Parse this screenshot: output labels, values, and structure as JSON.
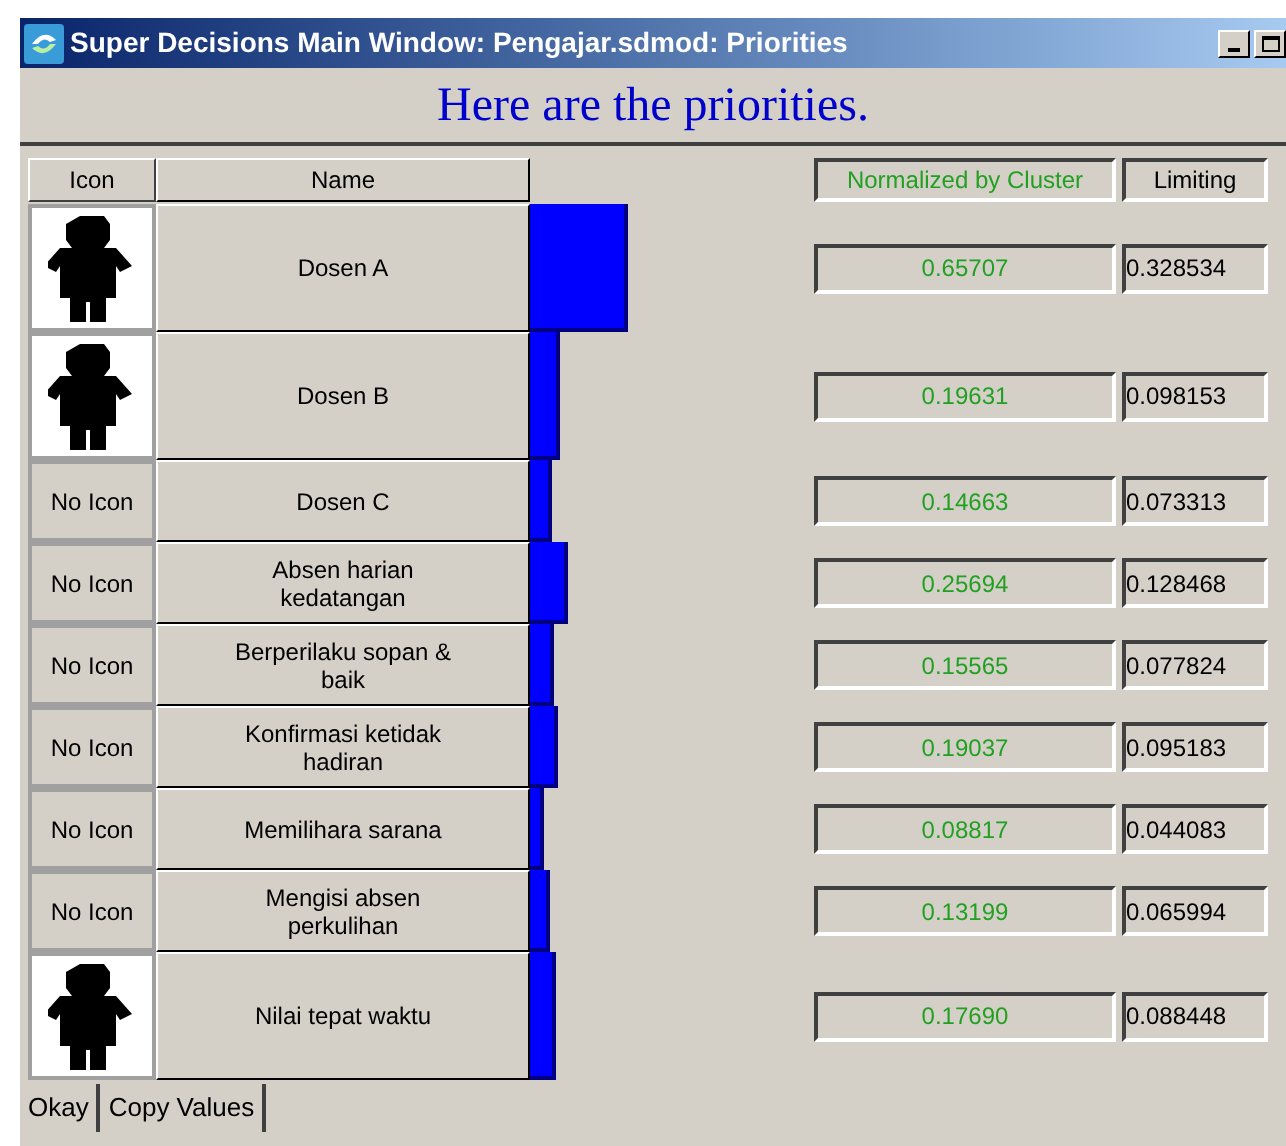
{
  "window": {
    "title": "Super Decisions Main Window: Pengajar.sdmod: Priorities"
  },
  "heading": "Here are the priorities.",
  "columns": {
    "icon": "Icon",
    "name": "Name",
    "normalized": "Normalized by Cluster",
    "limiting": "Limiting"
  },
  "rows": [
    {
      "icon": {
        "kind": "figure"
      },
      "name": "Dosen A",
      "normalized": "0.65707",
      "limiting": "0.328534"
    },
    {
      "icon": {
        "kind": "figure"
      },
      "name": "Dosen B",
      "normalized": "0.19631",
      "limiting": "0.098153"
    },
    {
      "icon": {
        "kind": "label",
        "text": "No Icon"
      },
      "name": "Dosen C",
      "normalized": "0.14663",
      "limiting": "0.073313"
    },
    {
      "icon": {
        "kind": "label",
        "text": "No Icon"
      },
      "name": "Absen harian kedatangan",
      "normalized": "0.25694",
      "limiting": "0.128468"
    },
    {
      "icon": {
        "kind": "label",
        "text": "No Icon"
      },
      "name": "Berperilaku sopan & baik",
      "normalized": "0.15565",
      "limiting": "0.077824"
    },
    {
      "icon": {
        "kind": "label",
        "text": "No Icon"
      },
      "name": "Konfirmasi ketidak hadiran",
      "normalized": "0.19037",
      "limiting": "0.095183"
    },
    {
      "icon": {
        "kind": "label",
        "text": "No Icon"
      },
      "name": "Memilihara sarana",
      "normalized": "0.08817",
      "limiting": "0.044083"
    },
    {
      "icon": {
        "kind": "label",
        "text": "No Icon"
      },
      "name": "Mengisi absen perkulihan",
      "normalized": "0.13199",
      "limiting": "0.065994"
    },
    {
      "icon": {
        "kind": "figure"
      },
      "name": "Nilai tepat waktu",
      "normalized": "0.17690",
      "limiting": "0.088448"
    }
  ],
  "buttons": [
    "Okay",
    "Copy Values"
  ]
}
